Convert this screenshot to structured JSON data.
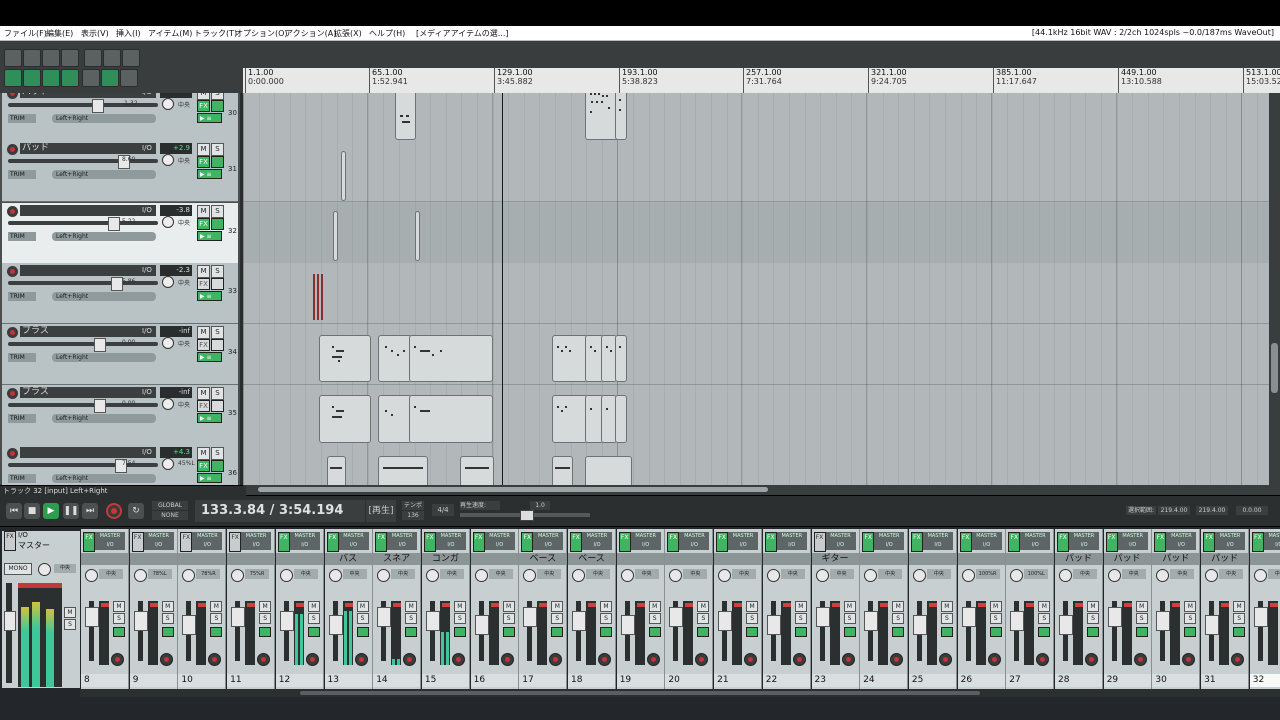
{
  "menu": {
    "items": [
      "ファイル(F)",
      "編集(E)",
      "表示(V)",
      "挿入(I)",
      "アイテム(M)",
      "トラック(T)",
      "オプション(O)",
      "アクション(A)",
      "拡張(X)",
      "ヘルプ(H)",
      "[メディアアイテムの選...]"
    ],
    "status": "[44.1kHz 16bit WAV : 2/2ch 1024spls ~0.0/187ms WaveOut]"
  },
  "ruler": {
    "marks": [
      {
        "bar": "1.1.00",
        "time": "0:00.000"
      },
      {
        "bar": "65.1.00",
        "time": "1:52.941"
      },
      {
        "bar": "129.1.00",
        "time": "3:45.882"
      },
      {
        "bar": "193.1.00",
        "time": "5:38.823"
      },
      {
        "bar": "257.1.00",
        "time": "7:31.764"
      },
      {
        "bar": "321.1.00",
        "time": "9:24.705"
      },
      {
        "bar": "385.1.00",
        "time": "11:17.647"
      },
      {
        "bar": "449.1.00",
        "time": "13:10.588"
      },
      {
        "bar": "513.1.00",
        "time": "15:03.52"
      }
    ]
  },
  "tracks": [
    {
      "name": "パッド",
      "vol": "-1.32",
      "pan": "中央",
      "io": "I/O",
      "trim": "TRIM",
      "input": "Left+Right",
      "num": "30",
      "fx_on": true,
      "read": "",
      "selected": false
    },
    {
      "name": "パッド",
      "vol": "8.60",
      "pan": "中央",
      "io": "I/O",
      "trim": "TRIM",
      "input": "Left+Right",
      "num": "31",
      "fx_on": true,
      "read": "+2.9",
      "selected": false
    },
    {
      "name": "",
      "vol": "5.22",
      "pan": "中央",
      "io": "I/O",
      "trim": "TRIM",
      "input": "Left+Right",
      "num": "32",
      "fx_on": true,
      "read": "-3.8",
      "selected": true
    },
    {
      "name": "",
      "vol": "5.86",
      "pan": "中央",
      "io": "I/O",
      "trim": "TRIM",
      "input": "Left+Right",
      "num": "33",
      "fx_on": false,
      "read": "-2.3",
      "selected": false
    },
    {
      "name": "ブラス",
      "vol": "0.00",
      "pan": "中央",
      "io": "I/O",
      "trim": "TRIM",
      "input": "Left+Right",
      "num": "34",
      "fx_on": false,
      "read": "-inf",
      "selected": false
    },
    {
      "name": "ブラス",
      "vol": "0.00",
      "pan": "中央",
      "io": "I/O",
      "trim": "TRIM",
      "input": "Left+Right",
      "num": "35",
      "fx_on": false,
      "read": "-inf",
      "selected": false
    },
    {
      "name": "",
      "vol": "7.54",
      "pan": "45%L",
      "io": "I/O",
      "trim": "TRIM",
      "input": "Left+Right",
      "num": "36",
      "fx_on": true,
      "read": "+4.3",
      "selected": false
    }
  ],
  "items": {
    "lane4_labels": [
      "ブラス",
      "無",
      "ブラス",
      "ブラス",
      "無題のMIDIア...",
      "ブラス"
    ],
    "lane5_labels": [
      "ブラス",
      "無",
      "ブラス",
      "ブラス",
      "無題のMIDIア...",
      "ブラス"
    ],
    "lane6_labels": [
      "33-220303...",
      "33-2...",
      "35-220314..."
    ]
  },
  "track_info": "トラック 32 [input] Left+Right",
  "transport": {
    "position": "133.3.84 / 3:54.194",
    "state": "[再生]",
    "global_auto": "GLOBAL AUTO",
    "none": "NONE",
    "tempo_label": "テンポ",
    "tempo": "136",
    "timesig": "4/4",
    "rate_label": "再生速度:",
    "rate": "1.0",
    "sel_label": "選択範囲:",
    "sel_start": "219.4.00",
    "sel_end": "219.4.00",
    "sel_len": "0.0.00"
  },
  "master": {
    "label": "マスター",
    "mono": "MONO",
    "pan": "中央",
    "io": "I/O",
    "fx": "FX"
  },
  "mixer": [
    {
      "num": "8",
      "name": "",
      "pan": "中央",
      "fx": true,
      "level": 0
    },
    {
      "num": "9",
      "name": "",
      "pan": "78%L",
      "fx": false,
      "level": 0
    },
    {
      "num": "10",
      "name": "",
      "pan": "78%R",
      "fx": false,
      "level": 0
    },
    {
      "num": "11",
      "name": "",
      "pan": "75%R",
      "fx": false,
      "level": 0
    },
    {
      "num": "12",
      "name": "",
      "pan": "中央",
      "fx": true,
      "level": 0.85
    },
    {
      "num": "13",
      "name": "バス",
      "pan": "中央",
      "fx": true,
      "level": 0.9
    },
    {
      "num": "14",
      "name": "スネア",
      "pan": "中央",
      "fx": true,
      "level": 0.1
    },
    {
      "num": "15",
      "name": "コンガ",
      "pan": "中央",
      "fx": true,
      "level": 0.55
    },
    {
      "num": "16",
      "name": "",
      "pan": "中央",
      "fx": true,
      "level": 0
    },
    {
      "num": "17",
      "name": "ベース",
      "pan": "中央",
      "fx": true,
      "level": 0
    },
    {
      "num": "18",
      "name": "ベース",
      "pan": "中央",
      "fx": true,
      "level": 0
    },
    {
      "num": "19",
      "name": "",
      "pan": "中央",
      "fx": true,
      "level": 0
    },
    {
      "num": "20",
      "name": "",
      "pan": "中央",
      "fx": true,
      "level": 0
    },
    {
      "num": "21",
      "name": "",
      "pan": "中央",
      "fx": true,
      "level": 0
    },
    {
      "num": "22",
      "name": "",
      "pan": "中央",
      "fx": true,
      "level": 0
    },
    {
      "num": "23",
      "name": "ギター",
      "pan": "中央",
      "fx": false,
      "level": 0
    },
    {
      "num": "24",
      "name": "",
      "pan": "中央",
      "fx": true,
      "level": 0
    },
    {
      "num": "25",
      "name": "",
      "pan": "中央",
      "fx": true,
      "level": 0
    },
    {
      "num": "26",
      "name": "",
      "pan": "100%R",
      "fx": true,
      "level": 0
    },
    {
      "num": "27",
      "name": "",
      "pan": "100%L",
      "fx": true,
      "level": 0
    },
    {
      "num": "28",
      "name": "パッド",
      "pan": "中央",
      "fx": true,
      "level": 0
    },
    {
      "num": "29",
      "name": "パッド",
      "pan": "中央",
      "fx": true,
      "level": 0
    },
    {
      "num": "30",
      "name": "パッド",
      "pan": "中央",
      "fx": true,
      "level": 0
    },
    {
      "num": "31",
      "name": "パッド",
      "pan": "中央",
      "fx": true,
      "level": 0
    },
    {
      "num": "32",
      "name": "",
      "pan": "中央",
      "fx": true,
      "level": 0
    }
  ],
  "colors": {
    "accent_green": "#3fb463",
    "meter": "#3fc79a",
    "rec": "#c0343a"
  }
}
